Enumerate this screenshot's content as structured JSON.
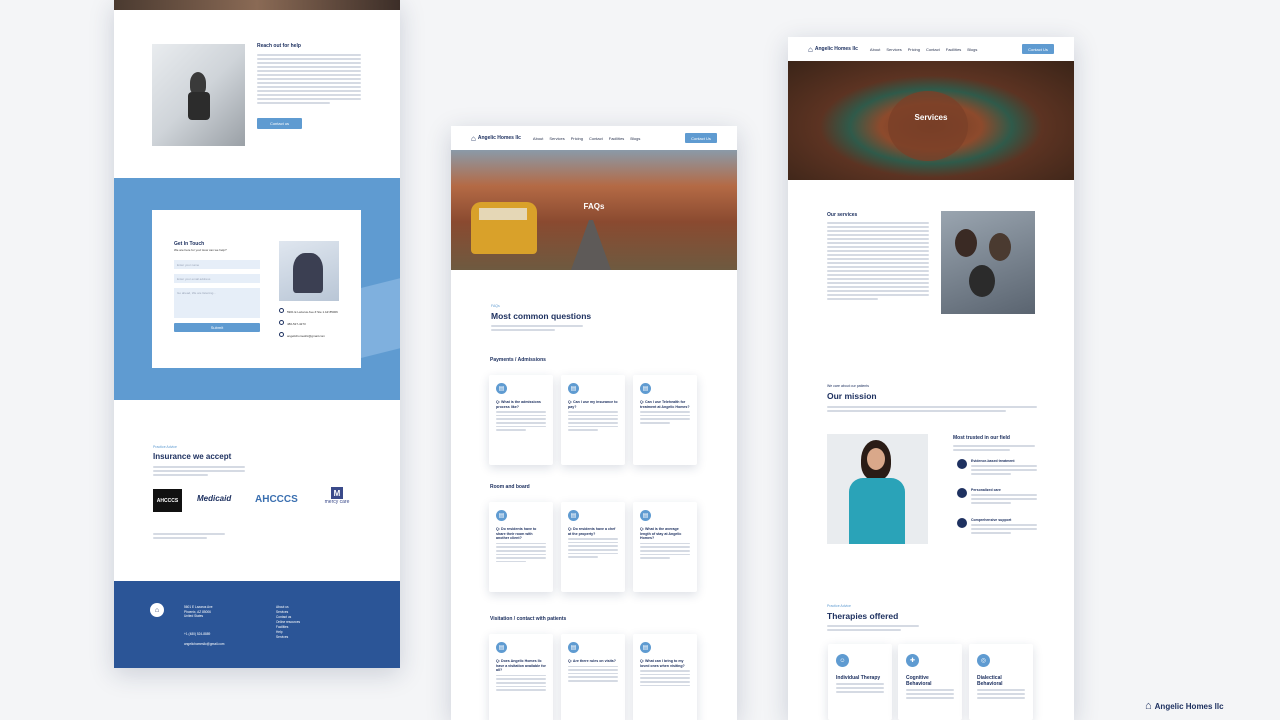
{
  "brand": {
    "name": "Angelic Homes llc"
  },
  "nav": {
    "items": [
      "About",
      "Services",
      "Pricing",
      "Contact",
      "Facilities",
      "Blogs"
    ],
    "contact_btn": "Contact Us"
  },
  "left": {
    "help": {
      "title": "Reach out for help",
      "button": "Contact us"
    },
    "contact": {
      "title": "Get In Touch",
      "subtitle": "We are here for you! How can we help?",
      "fields": [
        "Enter your name",
        "Enter your email address",
        "Go ahead, We are listening..."
      ],
      "submit": "Submit",
      "info": [
        "5901 E Lazarus Ave # Ste 1 AZ 85006",
        "480-527-4273",
        "angelichomesllc@gmail.com"
      ]
    },
    "insurance": {
      "eyebrow": "Practice Advice",
      "title": "Insurance we accept",
      "logos": [
        "AHCCCS",
        "Medicaid",
        "AHCCCS",
        "mercy care"
      ]
    },
    "footer": {
      "address": [
        "5601 E Lazarus Ave",
        "Phoenix, AZ 85006",
        "United States"
      ],
      "phone": "+1 (480) 524-8889",
      "email": "angelichomesllc@gmail.com",
      "links": [
        "About us",
        "Services",
        "Contact us",
        "Online resources",
        "Facilities",
        "Help",
        "Services"
      ]
    }
  },
  "middle": {
    "hero_title": "FAQs",
    "eyebrow": "FAQs",
    "title": "Most common questions",
    "sections": [
      {
        "title": "Payments / Admissions",
        "cards": [
          "Q: What is the admissions process like?",
          "Q: Can I use my insurance to pay?",
          "Q: Can I use Telehealth for treatment at Angelic Homes?"
        ]
      },
      {
        "title": "Room and board",
        "cards": [
          "Q: Do residents have to share their room with another client?",
          "Q: Do residents have a chef at the property?",
          "Q: What is the average length of stay at Angelic Homes?"
        ]
      },
      {
        "title": "Visitation / contact with patients",
        "cards": [
          "Q: Does Angelic Homes llc have a visitation available for all?",
          "Q: Are there rules on visits?",
          "Q: What can I bring to my loved ones when visiting?"
        ]
      }
    ]
  },
  "right": {
    "hero_title": "Services",
    "services": {
      "title": "Our services"
    },
    "mission": {
      "eyebrow": "We care about our patients",
      "title": "Our mission"
    },
    "trusted": {
      "title": "Most trusted in our field",
      "features": [
        "Evidence-based treatment",
        "Personalized care",
        "Comprehensive support"
      ]
    },
    "therapies": {
      "eyebrow": "Practice Advice",
      "title": "Therapies offered",
      "items": [
        "Individual Therapy",
        "Cognitive Behavioral",
        "Dialectical Behavioral"
      ]
    }
  },
  "watermark": "Angelic Homes llc",
  "colors": {
    "accent": "#5f9bd1",
    "navy": "#1e3160",
    "footer": "#2b5597"
  }
}
